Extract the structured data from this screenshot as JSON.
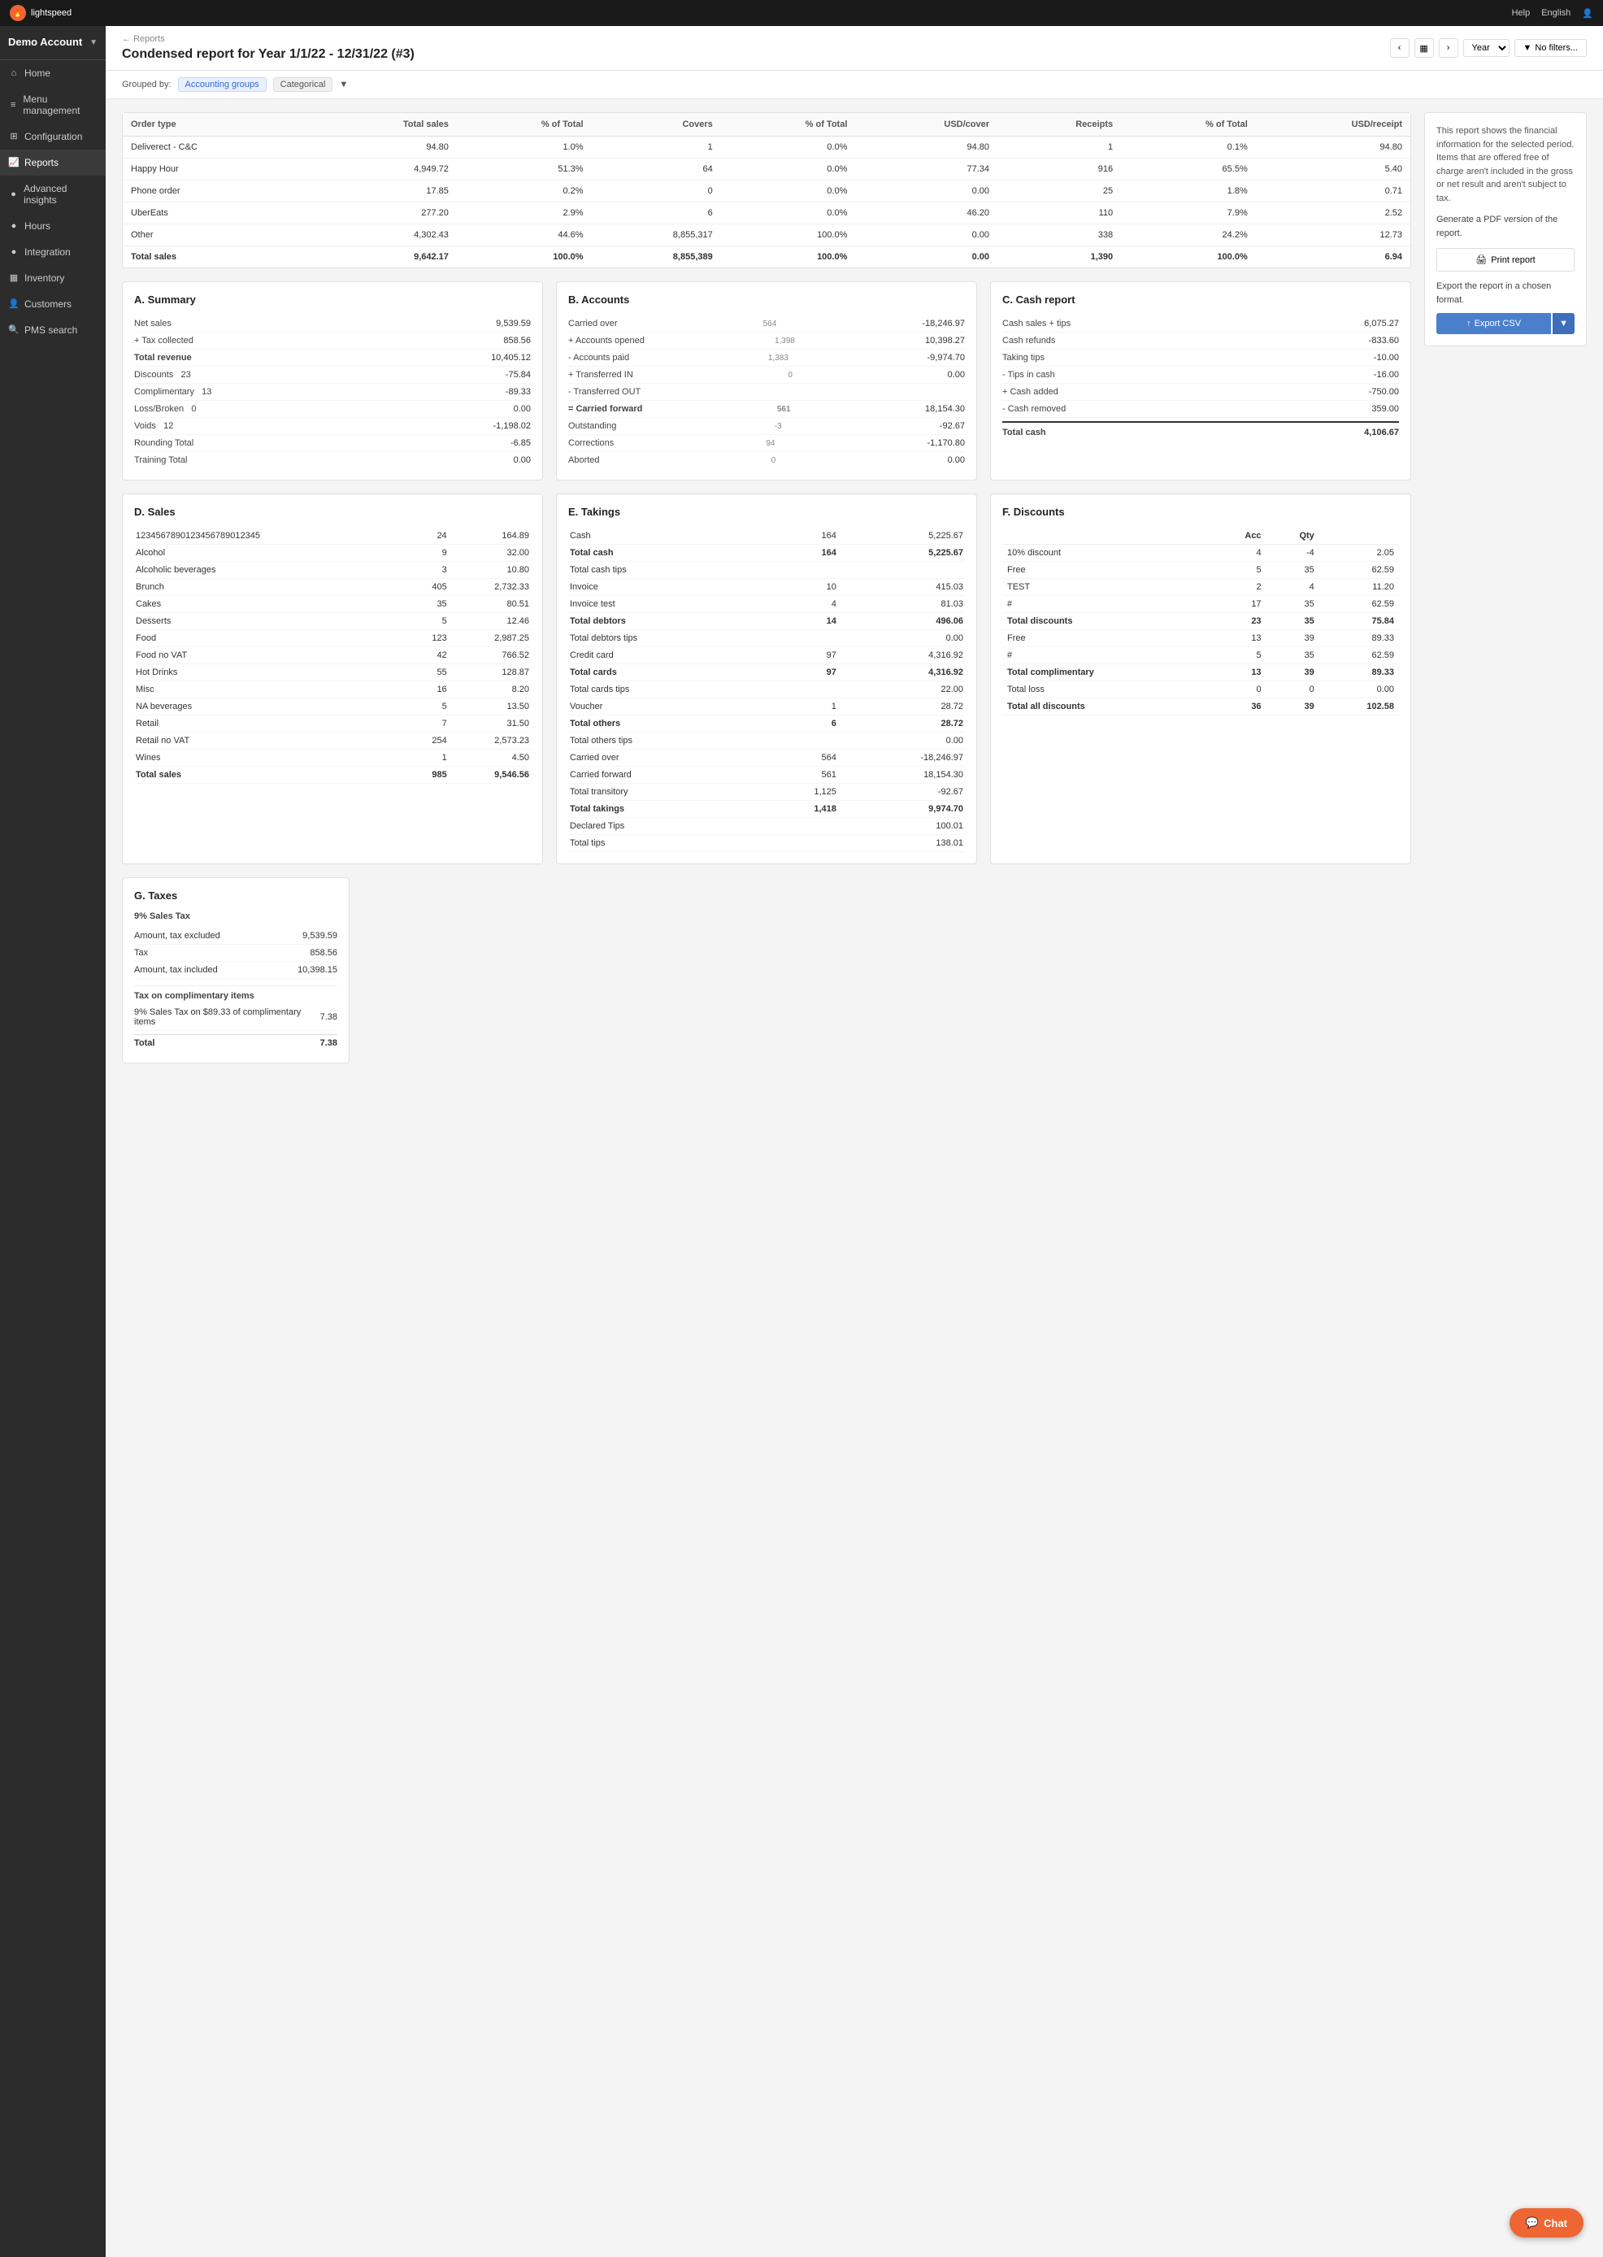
{
  "topnav": {
    "brand": "lightspeed",
    "help_label": "Help",
    "english_label": "English"
  },
  "sidebar": {
    "account_name": "Demo Account",
    "items": [
      {
        "label": "Home",
        "icon": "⌂"
      },
      {
        "label": "Menu management",
        "icon": "≡"
      },
      {
        "label": "Configuration",
        "icon": "⊞"
      },
      {
        "label": "Reports",
        "icon": "📈",
        "active": true
      },
      {
        "label": "Advanced insights",
        "icon": "●"
      },
      {
        "label": "Hours",
        "icon": "●"
      },
      {
        "label": "Integration",
        "icon": "●"
      },
      {
        "label": "Inventory",
        "icon": "▦"
      },
      {
        "label": "Customers",
        "icon": "👤"
      },
      {
        "label": "PMS search",
        "icon": "🔍"
      }
    ]
  },
  "breadcrumb": "Reports",
  "page_title": "Condensed report for Year 1/1/22 - 12/31/22 (#3)",
  "group_by": {
    "label": "Grouped by:",
    "tag1": "Accounting groups",
    "tag2": "Categorical"
  },
  "year_select": "Year",
  "filter_label": "No filters...",
  "info_box_text": "This report shows the financial information for the selected period. Items that are offered free of charge aren't included in the gross or net result and aren't subject to tax.",
  "print_label": "Print report",
  "export_label": "Export CSV",
  "order_table": {
    "headers": [
      "Order type",
      "Total sales",
      "% of Total",
      "Covers",
      "% of Total",
      "USD/cover",
      "Receipts",
      "% of Total",
      "USD/receipt"
    ],
    "rows": [
      [
        "Deliverect - C&C",
        "94.80",
        "1.0%",
        "1",
        "0.0%",
        "94.80",
        "1",
        "0.1%",
        "94.80"
      ],
      [
        "Happy Hour",
        "4,949.72",
        "51.3%",
        "64",
        "0.0%",
        "77.34",
        "916",
        "65.5%",
        "5.40"
      ],
      [
        "Phone order",
        "17.85",
        "0.2%",
        "0",
        "0.0%",
        "0.00",
        "25",
        "1.8%",
        "0.71"
      ],
      [
        "UberEats",
        "277.20",
        "2.9%",
        "6",
        "0.0%",
        "46.20",
        "110",
        "7.9%",
        "2.52"
      ],
      [
        "Other",
        "4,302.43",
        "44.6%",
        "8,855,317",
        "100.0%",
        "0.00",
        "338",
        "24.2%",
        "12.73"
      ],
      [
        "Total sales",
        "9,642.17",
        "100.0%",
        "8,855,389",
        "100.0%",
        "0.00",
        "1,390",
        "100.0%",
        "6.94"
      ]
    ]
  },
  "summary": {
    "title": "A. Summary",
    "rows": [
      {
        "label": "Net sales",
        "value": "9,539.59"
      },
      {
        "label": "+ Tax collected",
        "value": "858.56"
      },
      {
        "label": "Total revenue",
        "value": "10,405.12",
        "bold": true
      },
      {
        "label": "Discounts   23",
        "value": "-75.84"
      },
      {
        "label": "Complimentary   13",
        "value": "-89.33"
      },
      {
        "label": "Loss/Broken   0",
        "value": "0.00"
      },
      {
        "label": "Voids   12",
        "value": "-1,198.02"
      },
      {
        "label": "Rounding Total",
        "value": "-6.85"
      },
      {
        "label": "Training Total",
        "value": "0.00"
      }
    ]
  },
  "accounts": {
    "title": "B. Accounts",
    "rows": [
      {
        "label": "Carried over",
        "qty": "564",
        "value": "-18,246.97"
      },
      {
        "label": "+ Accounts opened",
        "qty": "1,398",
        "value": "10,398.27"
      },
      {
        "label": "- Accounts paid",
        "qty": "1,383",
        "value": "-9,974.70"
      },
      {
        "label": "+ Transferred IN",
        "qty": "0",
        "value": "0.00"
      },
      {
        "label": "- Transferred OUT",
        "qty": "",
        "value": ""
      },
      {
        "label": "= Carried forward",
        "qty": "561",
        "value": "18,154.30"
      },
      {
        "label": "Outstanding",
        "qty": "-3",
        "value": "-92.67"
      },
      {
        "label": "Corrections",
        "qty": "94",
        "value": "-1,170.80"
      },
      {
        "label": "Aborted",
        "qty": "0",
        "value": "0.00"
      }
    ]
  },
  "cash_report": {
    "title": "C. Cash report",
    "rows": [
      {
        "label": "Cash sales + tips",
        "value": "6,075.27"
      },
      {
        "label": "Cash refunds",
        "value": "-833.60"
      },
      {
        "label": "Taking tips",
        "value": "-10.00"
      },
      {
        "label": "- Tips in cash",
        "value": "-16.00"
      },
      {
        "label": "+ Cash added",
        "value": "-750.00"
      },
      {
        "label": "- Cash removed",
        "value": "359.00"
      },
      {
        "label": "Total cash",
        "value": "4,106.67",
        "bold": true
      }
    ]
  },
  "sales": {
    "title": "D. Sales",
    "rows": [
      {
        "label": "1234567890123456789012345",
        "qty": "24",
        "value": "164.89"
      },
      {
        "label": "Alcohol",
        "qty": "9",
        "value": "32.00"
      },
      {
        "label": "Alcoholic beverages",
        "qty": "3",
        "value": "10.80"
      },
      {
        "label": "Brunch",
        "qty": "405",
        "value": "2,732.33"
      },
      {
        "label": "Cakes",
        "qty": "35",
        "value": "80.51"
      },
      {
        "label": "Desserts",
        "qty": "5",
        "value": "12.46"
      },
      {
        "label": "Food",
        "qty": "123",
        "value": "2,987.25"
      },
      {
        "label": "Food no VAT",
        "qty": "42",
        "value": "766.52"
      },
      {
        "label": "Hot Drinks",
        "qty": "55",
        "value": "128.87"
      },
      {
        "label": "Misc",
        "qty": "16",
        "value": "8.20"
      },
      {
        "label": "NA beverages",
        "qty": "5",
        "value": "13.50"
      },
      {
        "label": "Retail",
        "qty": "7",
        "value": "31.50"
      },
      {
        "label": "Retail no VAT",
        "qty": "254",
        "value": "2,573.23"
      },
      {
        "label": "Wines",
        "qty": "1",
        "value": "4.50"
      },
      {
        "label": "Total sales",
        "qty": "985",
        "value": "9,546.56",
        "bold": true
      }
    ]
  },
  "takings": {
    "title": "E. Takings",
    "rows": [
      {
        "label": "Cash",
        "qty": "164",
        "value": "5,225.67"
      },
      {
        "label": "Total cash",
        "qty": "164",
        "value": "5,225.67",
        "bold": true
      },
      {
        "label": "Total cash tips",
        "qty": "",
        "value": ""
      },
      {
        "label": "Invoice",
        "qty": "10",
        "value": "415.03"
      },
      {
        "label": "Invoice test",
        "qty": "4",
        "value": "81.03"
      },
      {
        "label": "Total debtors",
        "qty": "14",
        "value": "496.06",
        "bold": true
      },
      {
        "label": "Total debtors tips",
        "qty": "",
        "value": "0.00"
      },
      {
        "label": "Credit card",
        "qty": "97",
        "value": "4,316.92"
      },
      {
        "label": "Total cards",
        "qty": "97",
        "value": "4,316.92",
        "bold": true
      },
      {
        "label": "Total cards tips",
        "qty": "",
        "value": "22.00"
      },
      {
        "label": "Voucher",
        "qty": "1",
        "value": "28.72"
      },
      {
        "label": "Total others",
        "qty": "6",
        "value": "28.72",
        "bold": true
      },
      {
        "label": "Total others tips",
        "qty": "",
        "value": "0.00"
      },
      {
        "label": "Carried over",
        "qty": "564",
        "value": "-18,246.97"
      },
      {
        "label": "Carried forward",
        "qty": "561",
        "value": "18,154.30"
      },
      {
        "label": "Total transitory",
        "qty": "1,125",
        "value": "-92.67"
      },
      {
        "label": "Total takings",
        "qty": "1,418",
        "value": "9,974.70",
        "bold": true
      },
      {
        "label": "Declared Tips",
        "qty": "",
        "value": "100.01"
      },
      {
        "label": "Total tips",
        "qty": "",
        "value": "138.01"
      }
    ]
  },
  "discounts": {
    "title": "F. Discounts",
    "headers": [
      "",
      "Acc",
      "Qty",
      ""
    ],
    "rows": [
      {
        "label": "10% discount",
        "acc": "4",
        "qty": "-4",
        "value": "2.05"
      },
      {
        "label": "Free",
        "acc": "5",
        "qty": "35",
        "value": "62.59"
      },
      {
        "label": "TEST",
        "acc": "2",
        "qty": "4",
        "value": "11.20"
      },
      {
        "label": "#",
        "acc": "17",
        "qty": "35",
        "value": "62.59"
      },
      {
        "label": "Total discounts",
        "acc": "23",
        "qty": "35",
        "value": "75.84",
        "bold": true
      },
      {
        "label": "Free",
        "acc": "13",
        "qty": "39",
        "value": "89.33"
      },
      {
        "label": "#",
        "acc": "5",
        "qty": "35",
        "value": "62.59"
      },
      {
        "label": "Total complimentary",
        "acc": "13",
        "qty": "39",
        "value": "89.33",
        "bold": true
      },
      {
        "label": "Total loss",
        "acc": "0",
        "qty": "0",
        "value": "0.00"
      },
      {
        "label": "Total all discounts",
        "acc": "36",
        "qty": "39",
        "value": "102.58",
        "bold": true
      }
    ]
  },
  "taxes": {
    "title": "G. Taxes",
    "subtitle": "9% Sales Tax",
    "rows": [
      {
        "label": "Amount, tax excluded",
        "value": "9,539.59"
      },
      {
        "label": "Tax",
        "value": "858.56"
      },
      {
        "label": "Amount, tax included",
        "value": "10,398.15"
      },
      {
        "label": "Tax on complimentary items",
        "value": "",
        "subheader": true
      },
      {
        "label": "9% Sales Tax on $89.33 of complimentary items",
        "value": "7.38"
      },
      {
        "label": "Total",
        "value": "7.38",
        "bold": true
      }
    ]
  },
  "chat_label": "Chat"
}
